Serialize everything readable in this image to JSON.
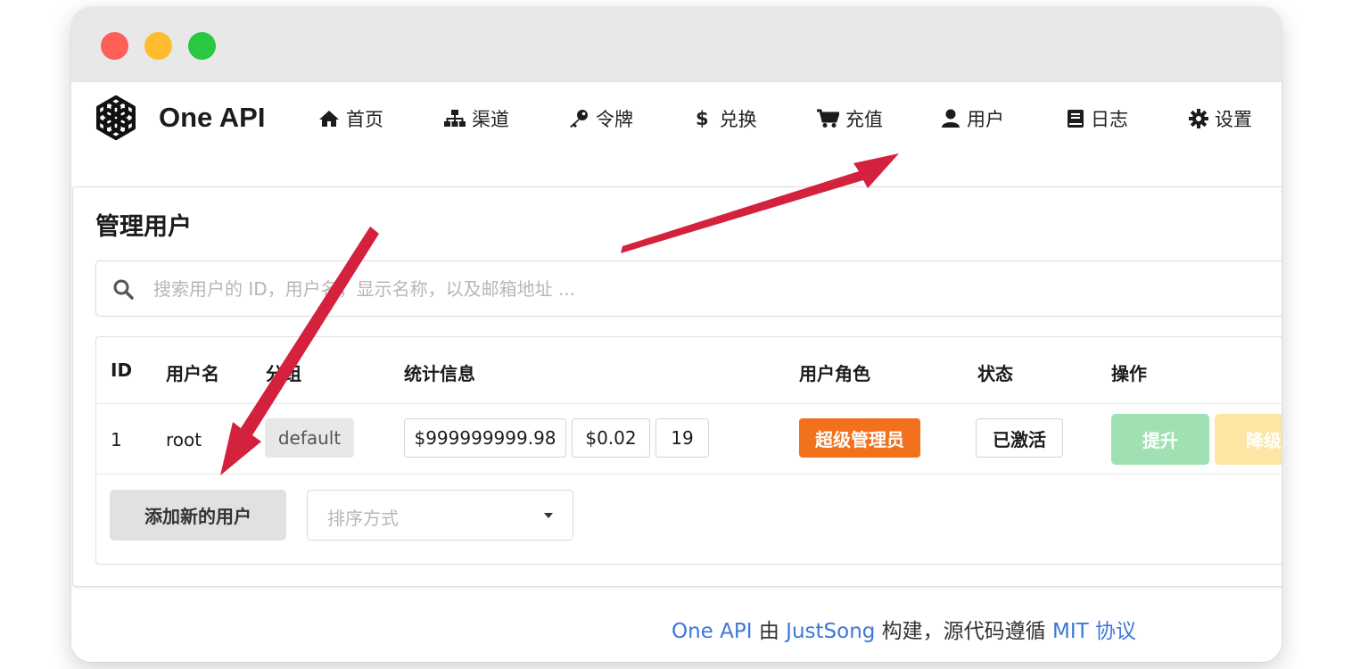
{
  "brand": {
    "name": "One API"
  },
  "nav": {
    "items": [
      {
        "label": "首页",
        "icon": "home-icon"
      },
      {
        "label": "渠道",
        "icon": "sitemap-icon"
      },
      {
        "label": "令牌",
        "icon": "key-icon"
      },
      {
        "label": "兑换",
        "icon": "dollar-icon"
      },
      {
        "label": "充值",
        "icon": "cart-icon"
      },
      {
        "label": "用户",
        "icon": "user-icon"
      },
      {
        "label": "日志",
        "icon": "book-icon"
      },
      {
        "label": "设置",
        "icon": "gear-icon"
      }
    ]
  },
  "page": {
    "title": "管理用户"
  },
  "search": {
    "placeholder": "搜索用户的 ID，用户名，显示名称，以及邮箱地址 ..."
  },
  "table": {
    "headers": [
      "ID",
      "用户名",
      "分组",
      "统计信息",
      "用户角色",
      "状态",
      "操作"
    ],
    "rows": [
      {
        "id": "1",
        "username": "root",
        "group": "default",
        "quota": "$999999999.98",
        "used": "$0.02",
        "requests": "19",
        "role": "超级管理员",
        "status": "已激活",
        "promote": "提升",
        "demote": "降级"
      }
    ]
  },
  "actions": {
    "add_user": "添加新的用户",
    "sort_placeholder": "排序方式"
  },
  "footer": {
    "part1": "One API",
    "part2": " 由 ",
    "part3": "JustSong",
    "part4": " 构建，源代码遵循 ",
    "part5": "MIT 协议"
  },
  "colors": {
    "accent_red": "#d4213d",
    "role_badge": "#f2711c",
    "promote": "#a1e0b2",
    "demote": "#fde5a2",
    "link": "#3c78d8"
  }
}
